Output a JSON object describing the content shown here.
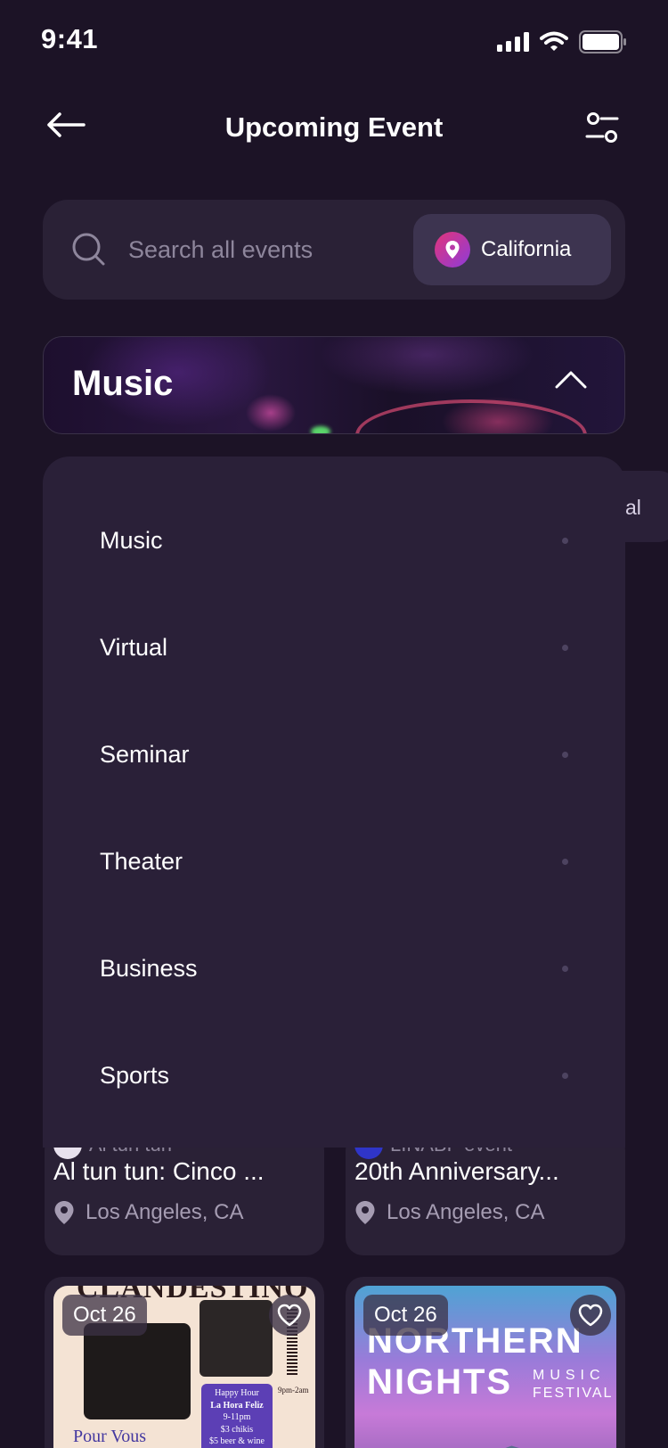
{
  "status_bar": {
    "time": "9:41"
  },
  "header": {
    "title": "Upcoming Event"
  },
  "search": {
    "placeholder": "Search all events",
    "location": "California"
  },
  "category_banner": {
    "title": "Music"
  },
  "dropdown": {
    "items": [
      {
        "label": "Music"
      },
      {
        "label": "Virtual"
      },
      {
        "label": "Seminar"
      },
      {
        "label": "Theater"
      },
      {
        "label": "Business"
      },
      {
        "label": "Sports"
      }
    ]
  },
  "peek_tab": {
    "label": "al"
  },
  "events": [
    {
      "organizer": "Al tun tun",
      "title": "Al tun tun: Cinco ...",
      "location": "Los Angeles, CA"
    },
    {
      "organizer": "LINABF event",
      "title": "20th Anniversary...",
      "location": "Los Angeles, CA"
    },
    {
      "date": "Oct 26",
      "poster_text": [
        "CLANDESTINO",
        "Pour Vous",
        "Happy Hour",
        "La Hora Feliz",
        "9-11pm",
        "$3 chikis",
        "$5 beer & wine",
        "9pm-2am"
      ]
    },
    {
      "date": "Oct 26",
      "poster_text": [
        "NORTHERN",
        "NIGHTS",
        "MUSIC",
        "FESTIVAL"
      ]
    }
  ],
  "colors": {
    "background": "#1c1326",
    "surface": "#2a2136",
    "accent_start": "#e2357a",
    "accent_end": "#8d3bd9"
  }
}
